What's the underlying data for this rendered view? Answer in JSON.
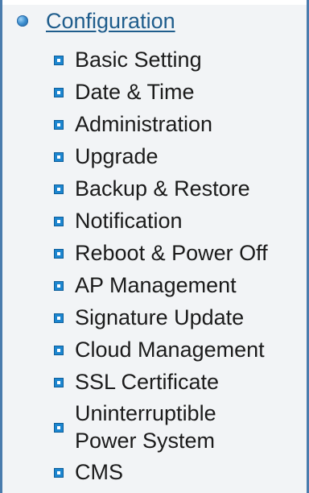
{
  "section": {
    "title": "Configuration",
    "icon": "globe-bullet-icon"
  },
  "menu": {
    "items": [
      {
        "label": "Basic Setting"
      },
      {
        "label": "Date & Time"
      },
      {
        "label": "Administration"
      },
      {
        "label": "Upgrade"
      },
      {
        "label": "Backup & Restore"
      },
      {
        "label": "Notification"
      },
      {
        "label": "Reboot & Power Off"
      },
      {
        "label": "AP Management"
      },
      {
        "label": "Signature Update"
      },
      {
        "label": "Cloud Management"
      },
      {
        "label": "SSL Certificate"
      },
      {
        "label": "Uninterruptible\nPower System"
      },
      {
        "label": "CMS"
      }
    ]
  },
  "colors": {
    "link": "#1f5d8c",
    "bullet": "#1c86d0",
    "border": "#4a7cad",
    "background": "#f2f4f6"
  }
}
